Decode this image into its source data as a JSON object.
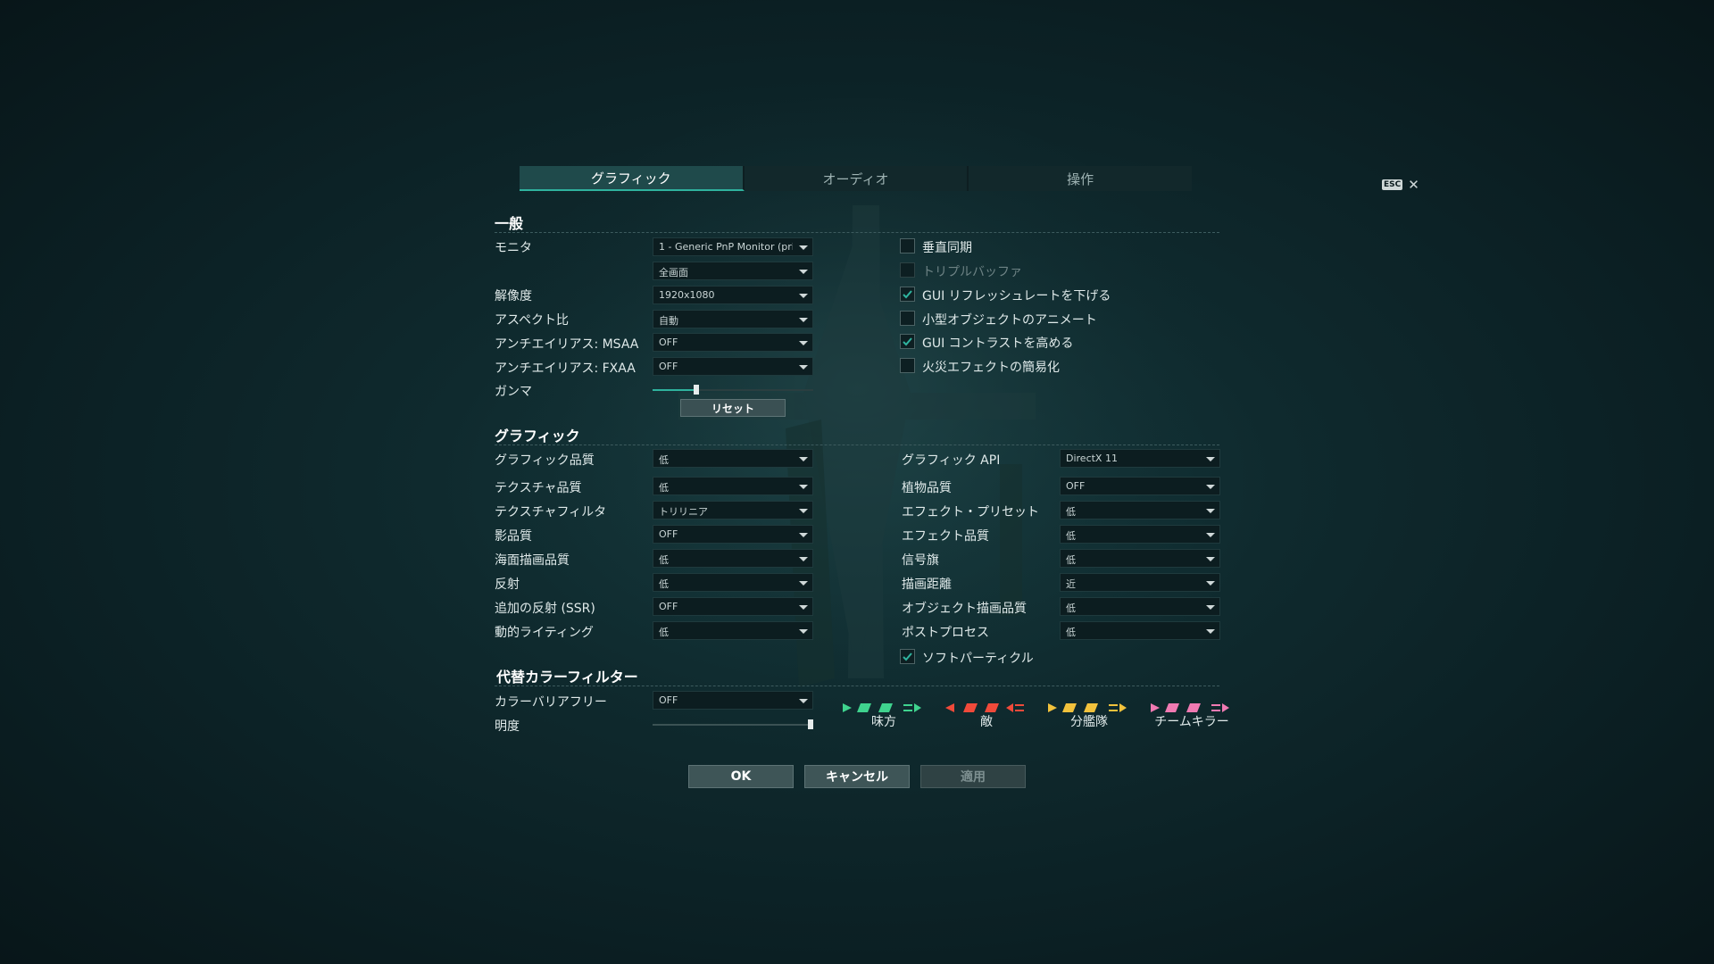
{
  "tabs": [
    {
      "label": "グラフィック",
      "active": true
    },
    {
      "label": "オーディオ",
      "active": false
    },
    {
      "label": "操作",
      "active": false
    }
  ],
  "esc": {
    "key": "ESC",
    "close": "✕"
  },
  "general": {
    "title": "一般",
    "monitor_label": "モニタ",
    "monitor_value": "1 - Generic PnP Monitor (prim",
    "mode_value": "全画面",
    "resolution_label": "解像度",
    "resolution_value": "1920x1080",
    "aspect_label": "アスペクト比",
    "aspect_value": "自動",
    "msaa_label": "アンチエイリアス: MSAA",
    "msaa_value": "OFF",
    "fxaa_label": "アンチエイリアス: FXAA",
    "fxaa_value": "OFF",
    "gamma_label": "ガンマ",
    "gamma_level": 0.27,
    "reset_label": "リセット",
    "checkboxes": [
      {
        "label": "垂直同期",
        "checked": false,
        "disabled": false
      },
      {
        "label": "トリプルバッファ",
        "checked": false,
        "disabled": true
      },
      {
        "label": "GUI リフレッシュレートを下げる",
        "checked": true,
        "disabled": false
      },
      {
        "label": "小型オブジェクトのアニメート",
        "checked": false,
        "disabled": false
      },
      {
        "label": "GUI コントラストを高める",
        "checked": true,
        "disabled": false
      },
      {
        "label": "火災エフェクトの簡易化",
        "checked": false,
        "disabled": false
      }
    ]
  },
  "graphics": {
    "title": "グラフィック",
    "left": [
      {
        "label": "グラフィック品質",
        "value": "低"
      },
      {
        "label": "テクスチャ品質",
        "value": "低"
      },
      {
        "label": "テクスチャフィルタ",
        "value": "トリリニア"
      },
      {
        "label": "影品質",
        "value": "OFF"
      },
      {
        "label": "海面描画品質",
        "value": "低"
      },
      {
        "label": "反射",
        "value": "低"
      },
      {
        "label": "追加の反射 (SSR)",
        "value": "OFF"
      },
      {
        "label": "動的ライティング",
        "value": "低"
      }
    ],
    "right": [
      {
        "label": "グラフィック API",
        "value": "DirectX 11"
      },
      {
        "label": "植物品質",
        "value": "OFF"
      },
      {
        "label": "エフェクト・プリセット",
        "value": "低"
      },
      {
        "label": "エフェクト品質",
        "value": "低"
      },
      {
        "label": "信号旗",
        "value": "低"
      },
      {
        "label": "描画距離",
        "value": "近"
      },
      {
        "label": "オブジェクト描画品質",
        "value": "低"
      },
      {
        "label": "ポストプロセス",
        "value": "低"
      }
    ],
    "soft_particles_label": "ソフトパーティクル",
    "soft_particles_checked": true
  },
  "color_filter": {
    "title": "代替カラーフィルター",
    "barrier_free_label": "カラーバリアフリー",
    "barrier_free_value": "OFF",
    "brightness_label": "明度",
    "brightness_level": 1.0,
    "groups": [
      {
        "label": "味方",
        "color": "#3fd38e",
        "direction": "right"
      },
      {
        "label": "敵",
        "color": "#f04a3a",
        "direction": "left"
      },
      {
        "label": "分艦隊",
        "color": "#f2c23c",
        "direction": "right"
      },
      {
        "label": "チームキラー",
        "color": "#f07ab2",
        "direction": "right"
      }
    ]
  },
  "footer": {
    "ok": "OK",
    "cancel": "キャンセル",
    "apply": "適用"
  },
  "colors": {
    "accent": "#2fb39e",
    "background": "#0f2a2e"
  }
}
